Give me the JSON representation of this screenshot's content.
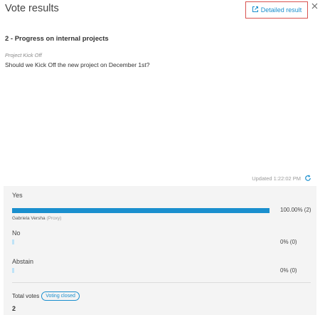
{
  "dialog": {
    "title": "Vote results",
    "detailed_result_label": "Detailed result"
  },
  "agenda": {
    "title": "2 - Progress on internal projects"
  },
  "question": {
    "context": "Project Kick Off",
    "text": "Should we Kick Off the new project on December 1st?"
  },
  "updated": {
    "label": "Updated 1:22:02 PM"
  },
  "results": [
    {
      "label": "Yes",
      "percent": 100,
      "value_text": "100.00% (2)",
      "voter": "Gabriela Versha",
      "voter_note": "(Proxy)"
    },
    {
      "label": "No",
      "percent": 0,
      "value_text": "0% (0)"
    },
    {
      "label": "Abstain",
      "percent": 0,
      "value_text": "0% (0)"
    }
  ],
  "totals": {
    "label": "Total votes",
    "status_badge": "Voting closed",
    "value": "2"
  },
  "colors": {
    "accent": "#1a8fce",
    "empty_bar": "#bfe3f7",
    "highlight_border": "#d9534f",
    "panel_bg": "#f4f4f4"
  },
  "icons": {
    "detailed_result": "external-link-icon",
    "close": "close-icon",
    "refresh": "refresh-icon"
  }
}
